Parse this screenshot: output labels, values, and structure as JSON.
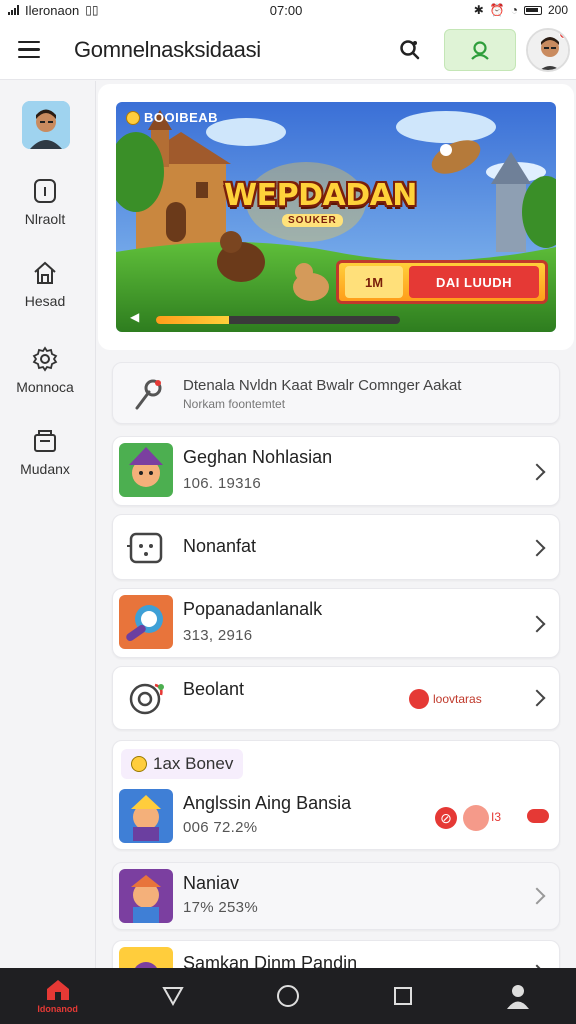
{
  "status_bar": {
    "carrier": "Ileronaon",
    "time": "07:00",
    "battery": "200"
  },
  "app_bar": {
    "title": "Gomnelnasksidaasi"
  },
  "sidebar": {
    "items": [
      {
        "label": "Nlraolt",
        "icon": "info-icon"
      },
      {
        "label": "Hesad",
        "icon": "home-icon"
      },
      {
        "label": "Monnoca",
        "icon": "gear-icon"
      },
      {
        "label": "Mudanx",
        "icon": "archive-icon"
      }
    ]
  },
  "banner": {
    "tag": "BOOIBEAB",
    "title": "WEPDADAN",
    "subtitle": "SOUKER",
    "cta_left": "1M",
    "cta_right": "DAI LUUDH",
    "progress": 0.3
  },
  "notice": {
    "title": "Dtenala Nvldn Kaat Bwalr Comnger Aakat",
    "subtitle": "Norkam foontemtet"
  },
  "list": [
    {
      "title": "Geghan Nohlasian",
      "subtitle": "106. 19316"
    },
    {
      "title": "Nonanfat",
      "subtitle": ""
    },
    {
      "title": "Popanadanlanalk",
      "subtitle": "313, 2916"
    },
    {
      "title": "Beolant",
      "subtitle": "",
      "tag": "loovtaras"
    }
  ],
  "section": {
    "badge": "1ax Bonev",
    "item": {
      "title": "Anglssin Aing Bansia",
      "subtitle": "006 72.2%",
      "tag": "I3"
    }
  },
  "list2": [
    {
      "title": "Naniav",
      "subtitle": "17% 253%"
    },
    {
      "title": "Samkan Dinm Pandin",
      "subtitle": ""
    }
  ],
  "bottom_nav": {
    "home_label": "Idonanod"
  }
}
